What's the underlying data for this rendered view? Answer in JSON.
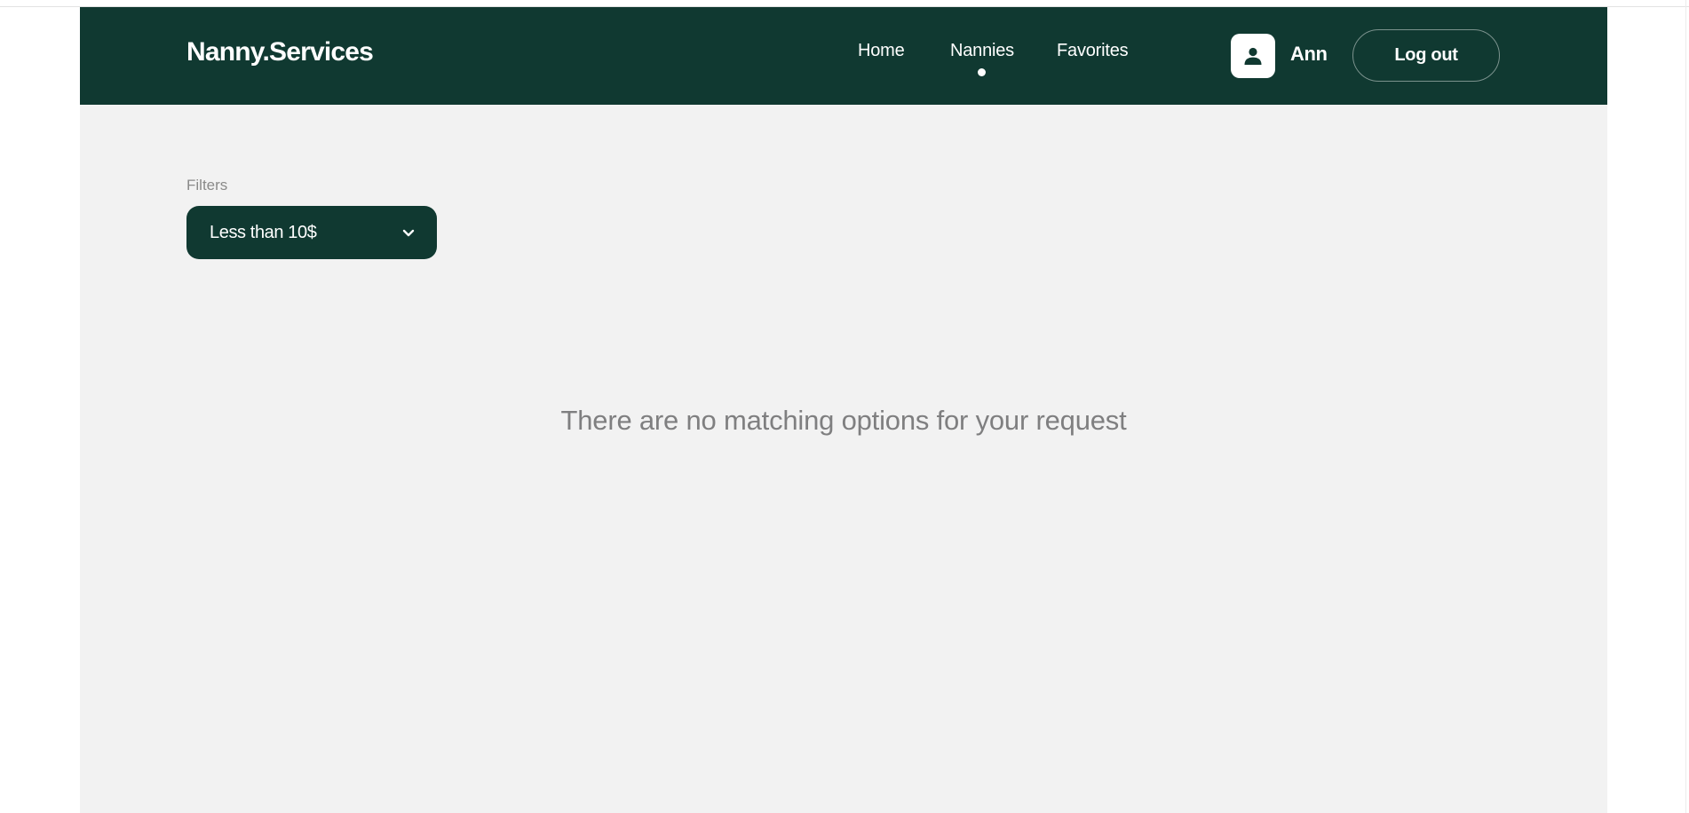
{
  "header": {
    "logo": "Nanny.Services",
    "nav": [
      {
        "label": "Home",
        "active": false
      },
      {
        "label": "Nannies",
        "active": true
      },
      {
        "label": "Favorites",
        "active": false
      }
    ],
    "user": {
      "name": "Ann",
      "avatar_icon": "user-icon"
    },
    "logout_label": "Log out"
  },
  "filters": {
    "label": "Filters",
    "selected": "Less than 10$",
    "dropdown_icon": "chevron-down-icon"
  },
  "empty_state": {
    "message": "There are no matching options for your request"
  },
  "colors": {
    "brand": "#103931",
    "page_background": "#f2f2f2",
    "muted_text": "#8a8a89",
    "white": "#ffffff"
  }
}
